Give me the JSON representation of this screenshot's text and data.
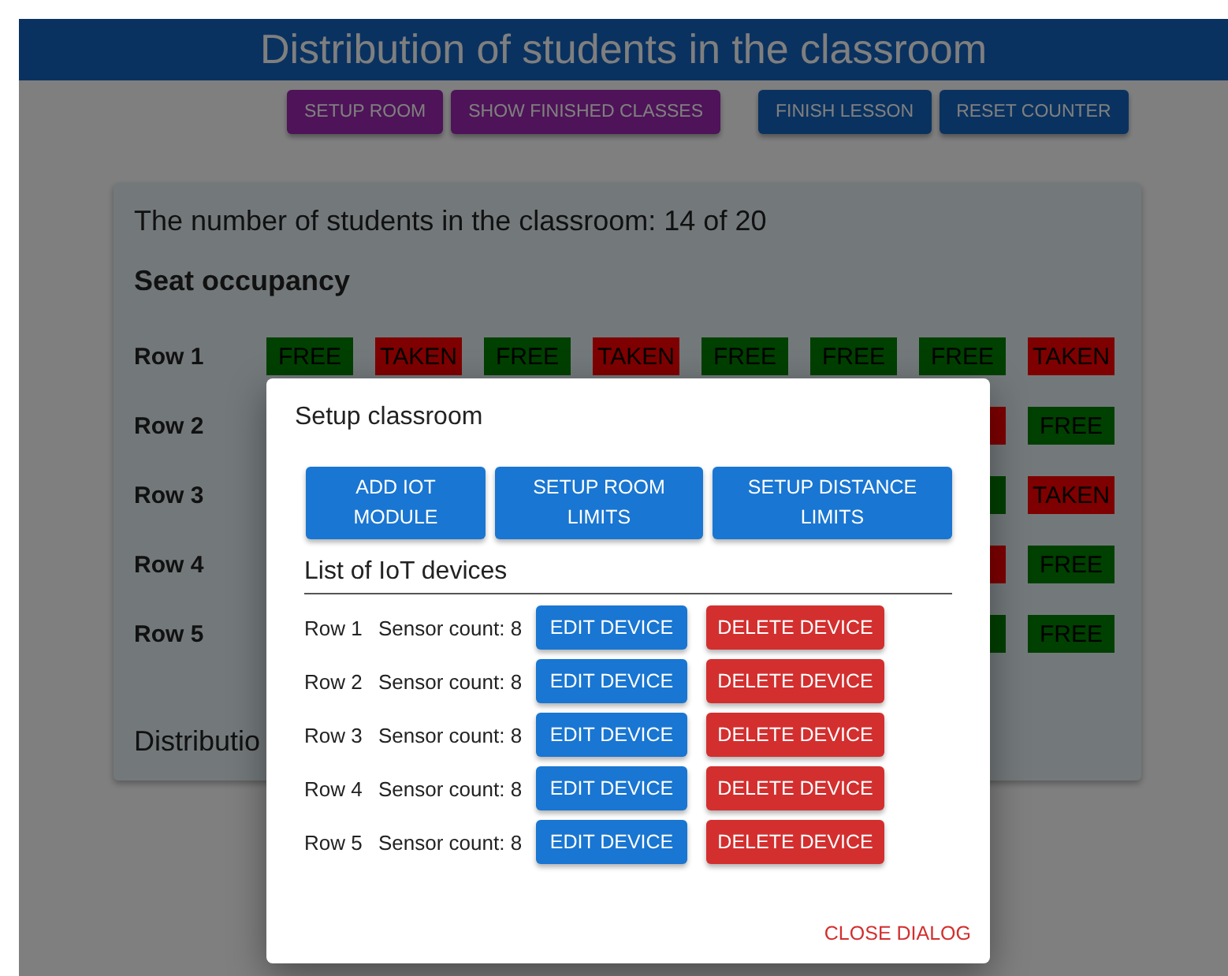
{
  "header": {
    "title": "Distribution of students in the classroom"
  },
  "toolbar": [
    {
      "label": "SETUP ROOM",
      "kind": "purple"
    },
    {
      "label": "SHOW FINISHED CLASSES",
      "kind": "purple"
    },
    {
      "label": "FINISH LESSON",
      "kind": "blue"
    },
    {
      "label": "RESET COUNTER",
      "kind": "blue"
    }
  ],
  "card": {
    "summary": "The number of students in the classroom: 14 of 20",
    "heading": "Seat occupancy",
    "rows": [
      {
        "label": "Row 1",
        "seats": [
          {
            "taken": false,
            "label": "FREE"
          },
          {
            "taken": true,
            "label": "TAKEN"
          },
          {
            "taken": false,
            "label": "FREE"
          },
          {
            "taken": true,
            "label": "TAKEN"
          },
          {
            "taken": false,
            "label": "FREE"
          },
          {
            "taken": false,
            "label": "FREE"
          },
          {
            "taken": false,
            "label": "FREE"
          },
          {
            "taken": true,
            "label": "TAKEN"
          }
        ]
      },
      {
        "label": "Row 2",
        "seats": [
          {
            "taken": true
          },
          {
            "taken": false,
            "label": "FREE"
          }
        ]
      },
      {
        "label": "Row 3",
        "seats": [
          {
            "taken": false
          },
          {
            "taken": true,
            "label": "TAKEN"
          }
        ]
      },
      {
        "label": "Row 4",
        "seats": [
          {
            "taken": true
          },
          {
            "taken": false,
            "label": "FREE"
          }
        ]
      },
      {
        "label": "Row 5",
        "seats": [
          {
            "taken": false
          },
          {
            "taken": false,
            "label": "FREE"
          }
        ]
      }
    ],
    "footer": "Distributio"
  },
  "dialog": {
    "title": "Setup classroom",
    "actions": [
      [
        "ADD IOT",
        "MODULE"
      ],
      [
        "SETUP ROOM",
        "LIMITS"
      ],
      [
        "SETUP DISTANCE",
        "LIMITS"
      ]
    ],
    "list_title": "List of IoT devices",
    "devices": [
      {
        "row": "Row 1",
        "sensors": "Sensor count: 8",
        "edit": "EDIT DEVICE",
        "delete": "DELETE DEVICE"
      },
      {
        "row": "Row 2",
        "sensors": "Sensor count: 8",
        "edit": "EDIT DEVICE",
        "delete": "DELETE DEVICE"
      },
      {
        "row": "Row 3",
        "sensors": "Sensor count: 8",
        "edit": "EDIT DEVICE",
        "delete": "DELETE DEVICE"
      },
      {
        "row": "Row 4",
        "sensors": "Sensor count: 8",
        "edit": "EDIT DEVICE",
        "delete": "DELETE DEVICE"
      },
      {
        "row": "Row 5",
        "sensors": "Sensor count: 8",
        "edit": "EDIT DEVICE",
        "delete": "DELETE DEVICE"
      }
    ],
    "close": "CLOSE DIALOG"
  }
}
